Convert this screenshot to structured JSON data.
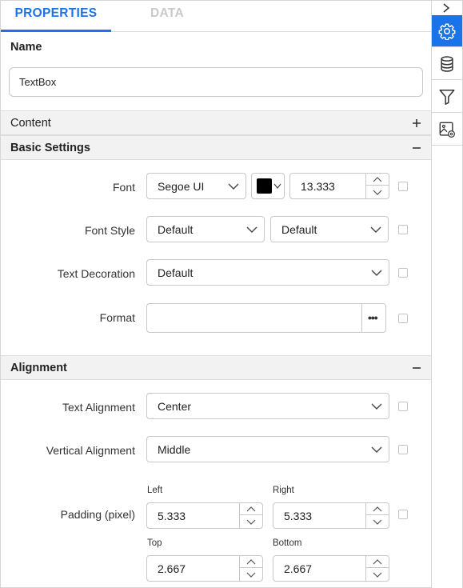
{
  "tabs": {
    "properties": "PROPERTIES",
    "data": "DATA"
  },
  "name": {
    "label": "Name",
    "value": "TextBox"
  },
  "sections": {
    "content": {
      "title": "Content",
      "toggle": "+"
    },
    "basic": {
      "title": "Basic Settings",
      "toggle": "−"
    },
    "alignment": {
      "title": "Alignment",
      "toggle": "−"
    }
  },
  "basic": {
    "font": {
      "label": "Font",
      "family": "Segoe UI",
      "color": "#000000",
      "size": "13.333"
    },
    "font_style": {
      "label": "Font Style",
      "style": "Default",
      "weight": "Default"
    },
    "text_decoration": {
      "label": "Text Decoration",
      "value": "Default"
    },
    "format": {
      "label": "Format",
      "value": "",
      "button": "•••"
    }
  },
  "alignment": {
    "text_alignment": {
      "label": "Text Alignment",
      "value": "Center"
    },
    "vertical_alignment": {
      "label": "Vertical Alignment",
      "value": "Middle"
    },
    "padding": {
      "label": "Padding (pixel)",
      "left_label": "Left",
      "left": "5.333",
      "right_label": "Right",
      "right": "5.333",
      "top_label": "Top",
      "top": "2.667",
      "bottom_label": "Bottom",
      "bottom": "2.667"
    }
  },
  "rail": {
    "icons": [
      "chevron-right-icon",
      "gear-icon",
      "database-icon",
      "filter-icon",
      "image-settings-icon"
    ],
    "active": "gear-icon",
    "accent": "#1a73e8"
  }
}
